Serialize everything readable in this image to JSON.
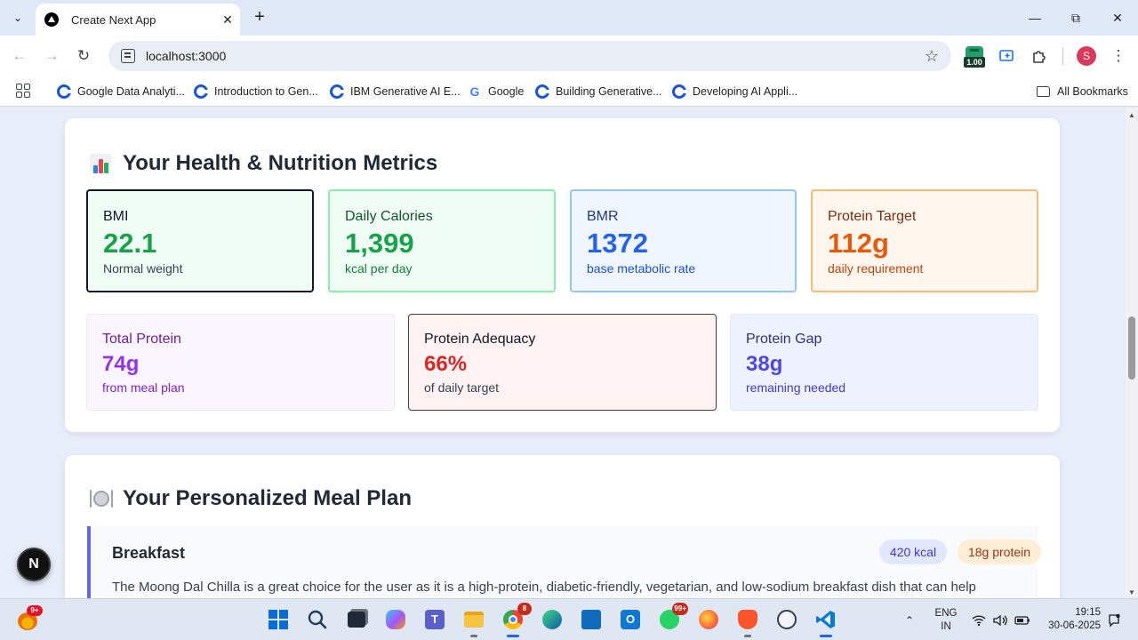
{
  "browser": {
    "tab_title": "Create Next App",
    "tab_close": "✕",
    "new_tab": "+",
    "url": "localhost:3000",
    "extension_badge": "1.00",
    "profile_initial": "S",
    "bookmarks": [
      {
        "label": "Google Data Analyti...",
        "icon": "coursera-icon"
      },
      {
        "label": "Introduction to Gen...",
        "icon": "coursera-icon"
      },
      {
        "label": "IBM Generative AI E...",
        "icon": "coursera-icon"
      },
      {
        "label": "Google",
        "icon": "google-icon"
      },
      {
        "label": "Building Generative...",
        "icon": "coursera-icon"
      },
      {
        "label": "Developing AI Appli...",
        "icon": "coursera-icon"
      }
    ],
    "all_bookmarks": "All Bookmarks"
  },
  "metrics_section": {
    "title": "Your Health & Nutrition Metrics",
    "icon": "bar-chart-icon",
    "cards": [
      {
        "label": "BMI",
        "value": "22.1",
        "sub": "Normal weight",
        "accent": "#16a34a",
        "bg": "#f0fdf4",
        "border": "#111827"
      },
      {
        "label": "Daily Calories",
        "value": "1,399",
        "sub": "kcal per day",
        "accent": "#16a34a",
        "bg": "#f0fdf4",
        "border": "#86efac"
      },
      {
        "label": "BMR",
        "value": "1372",
        "sub": "base metabolic rate",
        "accent": "#2563eb",
        "bg": "#eff6ff",
        "border": "#93c5fd"
      },
      {
        "label": "Protein Target",
        "value": "112g",
        "sub": "daily requirement",
        "accent": "#ea580c",
        "bg": "#fff7ed",
        "border": "#fdba74"
      },
      {
        "label": "Total Protein",
        "value": "74g",
        "sub": "from meal plan",
        "accent": "#9333ea",
        "bg": "#faf5ff",
        "border": "#ede9fe"
      },
      {
        "label": "Protein Adequacy",
        "value": "66%",
        "sub": "of daily target",
        "accent": "#dc2626",
        "bg": "#fef2f2",
        "border": "#374151"
      },
      {
        "label": "Protein Gap",
        "value": "38g",
        "sub": "remaining needed",
        "accent": "#4f46e5",
        "bg": "#eef2ff",
        "border": "#e0e7ff"
      }
    ]
  },
  "meal_section": {
    "title": "Your Personalized Meal Plan",
    "icon": "plate-icon",
    "meals": [
      {
        "name": "Breakfast",
        "kcal": "420 kcal",
        "protein": "18g protein",
        "description": "The Moong Dal Chilla is a great choice for the user as it is a high-protein, diabetic-friendly, vegetarian, and low-sodium breakfast dish that can help"
      }
    ]
  },
  "next_badge": "N",
  "taskbar": {
    "widget_badge": "9+",
    "chrome_badge": "8",
    "whatsapp_badge": "99+",
    "language_line1": "ENG",
    "language_line2": "IN",
    "time": "19:15",
    "date": "30-06-2025"
  }
}
